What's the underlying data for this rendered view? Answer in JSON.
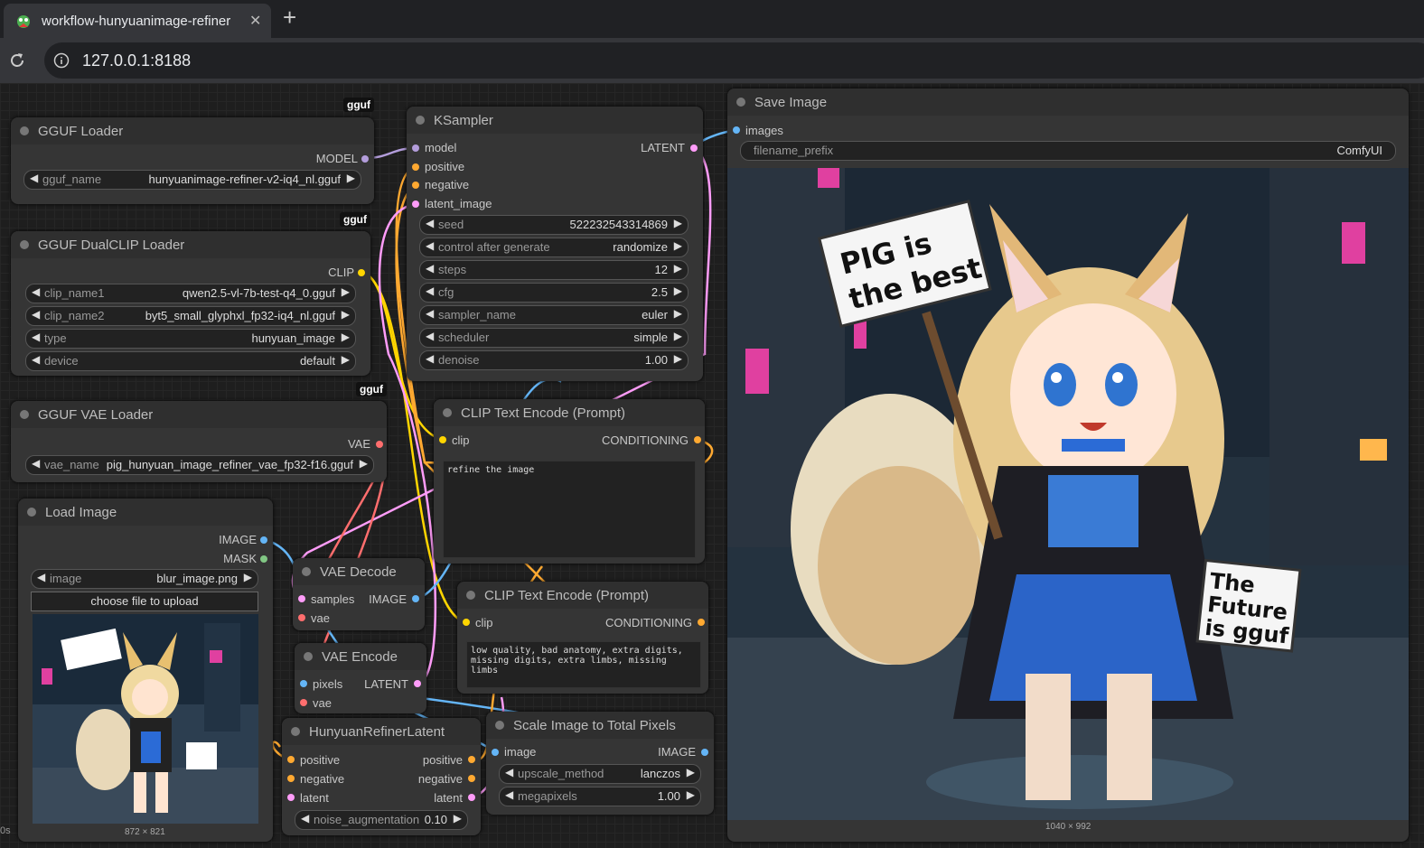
{
  "browser": {
    "tab_title": "workflow-hunyuanimage-refiner",
    "url": "127.0.0.1:8188"
  },
  "badges": {
    "gguf": "gguf"
  },
  "nodes": {
    "gguf_loader": {
      "title": "GGUF Loader",
      "output": "MODEL",
      "widgets": [
        {
          "label": "gguf_name",
          "value": "hunyuanimage-refiner-v2-iq4_nl.gguf"
        }
      ]
    },
    "dualclip": {
      "title": "GGUF DualCLIP Loader",
      "output": "CLIP",
      "widgets": [
        {
          "label": "clip_name1",
          "value": "qwen2.5-vl-7b-test-q4_0.gguf"
        },
        {
          "label": "clip_name2",
          "value": "byt5_small_glyphxl_fp32-iq4_nl.gguf"
        },
        {
          "label": "type",
          "value": "hunyuan_image"
        },
        {
          "label": "device",
          "value": "default"
        }
      ]
    },
    "vae_loader": {
      "title": "GGUF VAE Loader",
      "output": "VAE",
      "widgets": [
        {
          "label": "vae_name",
          "value": "pig_hunyuan_image_refiner_vae_fp32-f16.gguf"
        }
      ]
    },
    "load_image": {
      "title": "Load Image",
      "outputs": [
        "IMAGE",
        "MASK"
      ],
      "widgets": [
        {
          "label": "image",
          "value": "blur_image.png"
        }
      ],
      "upload_label": "choose file to upload",
      "size_caption": "872 × 821"
    },
    "ksampler": {
      "title": "KSampler",
      "inputs": [
        "model",
        "positive",
        "negative",
        "latent_image"
      ],
      "output": "LATENT",
      "widgets": [
        {
          "label": "seed",
          "value": "522232543314869"
        },
        {
          "label": "control after generate",
          "value": "randomize"
        },
        {
          "label": "steps",
          "value": "12"
        },
        {
          "label": "cfg",
          "value": "2.5"
        },
        {
          "label": "sampler_name",
          "value": "euler"
        },
        {
          "label": "scheduler",
          "value": "simple"
        },
        {
          "label": "denoise",
          "value": "1.00"
        }
      ]
    },
    "clip_pos": {
      "title": "CLIP Text Encode (Prompt)",
      "input": "clip",
      "output": "CONDITIONING",
      "text": "refine the image"
    },
    "clip_neg": {
      "title": "CLIP Text Encode (Prompt)",
      "input": "clip",
      "output": "CONDITIONING",
      "text": "low quality, bad anatomy, extra digits, missing digits, extra limbs, missing limbs"
    },
    "vae_decode": {
      "title": "VAE Decode",
      "inputs": [
        "samples",
        "vae"
      ],
      "output": "IMAGE"
    },
    "vae_encode": {
      "title": "VAE Encode",
      "inputs": [
        "pixels",
        "vae"
      ],
      "output": "LATENT"
    },
    "refiner_latent": {
      "title": "HunyuanRefinerLatent",
      "inputs": [
        "positive",
        "negative",
        "latent"
      ],
      "outputs": [
        "positive",
        "negative",
        "latent"
      ],
      "widgets": [
        {
          "label": "noise_augmentation",
          "value": "0.10"
        }
      ]
    },
    "scale_image": {
      "title": "Scale Image to Total Pixels",
      "input": "image",
      "output": "IMAGE",
      "widgets": [
        {
          "label": "upscale_method",
          "value": "lanczos"
        },
        {
          "label": "megapixels",
          "value": "1.00"
        }
      ]
    },
    "save_image": {
      "title": "Save Image",
      "input": "images",
      "widgets": [
        {
          "label": "filename_prefix",
          "value": "ComfyUI"
        }
      ],
      "size_caption": "1040 × 992",
      "sign1_text": "PIG is the best",
      "sign2_text": "The Future is gguf"
    }
  },
  "status": {
    "timer": "0s"
  },
  "colors": {
    "model": "#b39ddb",
    "clip": "#ffd500",
    "vae": "#ff6e6e",
    "image": "#64b5f6",
    "latent": "#ff9cf9",
    "conditioning": "#ffa931",
    "mask": "#81c784"
  }
}
